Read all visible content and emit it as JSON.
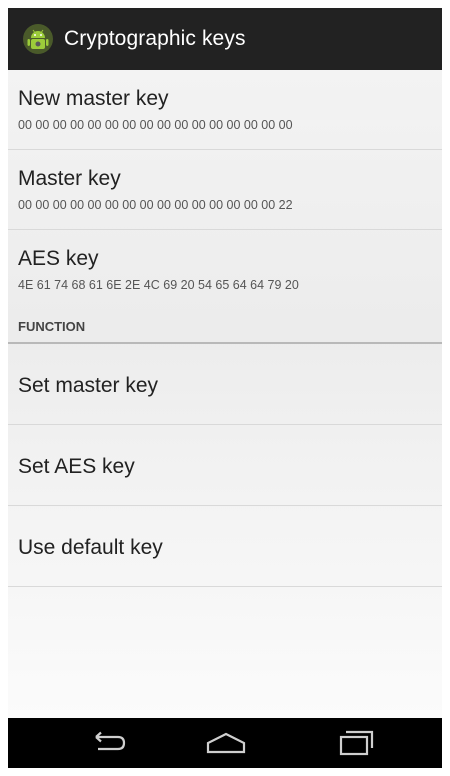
{
  "actionbar": {
    "title": "Cryptographic keys",
    "icon": "android-app-icon"
  },
  "preferences": [
    {
      "title": "New master key",
      "summary": "00 00 00 00 00 00 00 00 00 00 00 00 00 00 00 00"
    },
    {
      "title": "Master key",
      "summary": "00 00 00 00 00 00 00 00 00 00 00 00 00 00 00 22"
    },
    {
      "title": "AES key",
      "summary": "4E 61 74 68 61 6E 2E 4C 69 20 54 65 64 64 79 20"
    }
  ],
  "function_category": {
    "title": "FUNCTION",
    "items": [
      {
        "label": "Set master key"
      },
      {
        "label": "Set AES key"
      },
      {
        "label": "Use default key"
      }
    ]
  },
  "navbar": {
    "buttons": [
      "back-icon",
      "home-icon",
      "recent-apps-icon"
    ]
  },
  "colors": {
    "actionbar": "#222222",
    "navbar": "#000000",
    "android_green": "#8ec63f"
  }
}
